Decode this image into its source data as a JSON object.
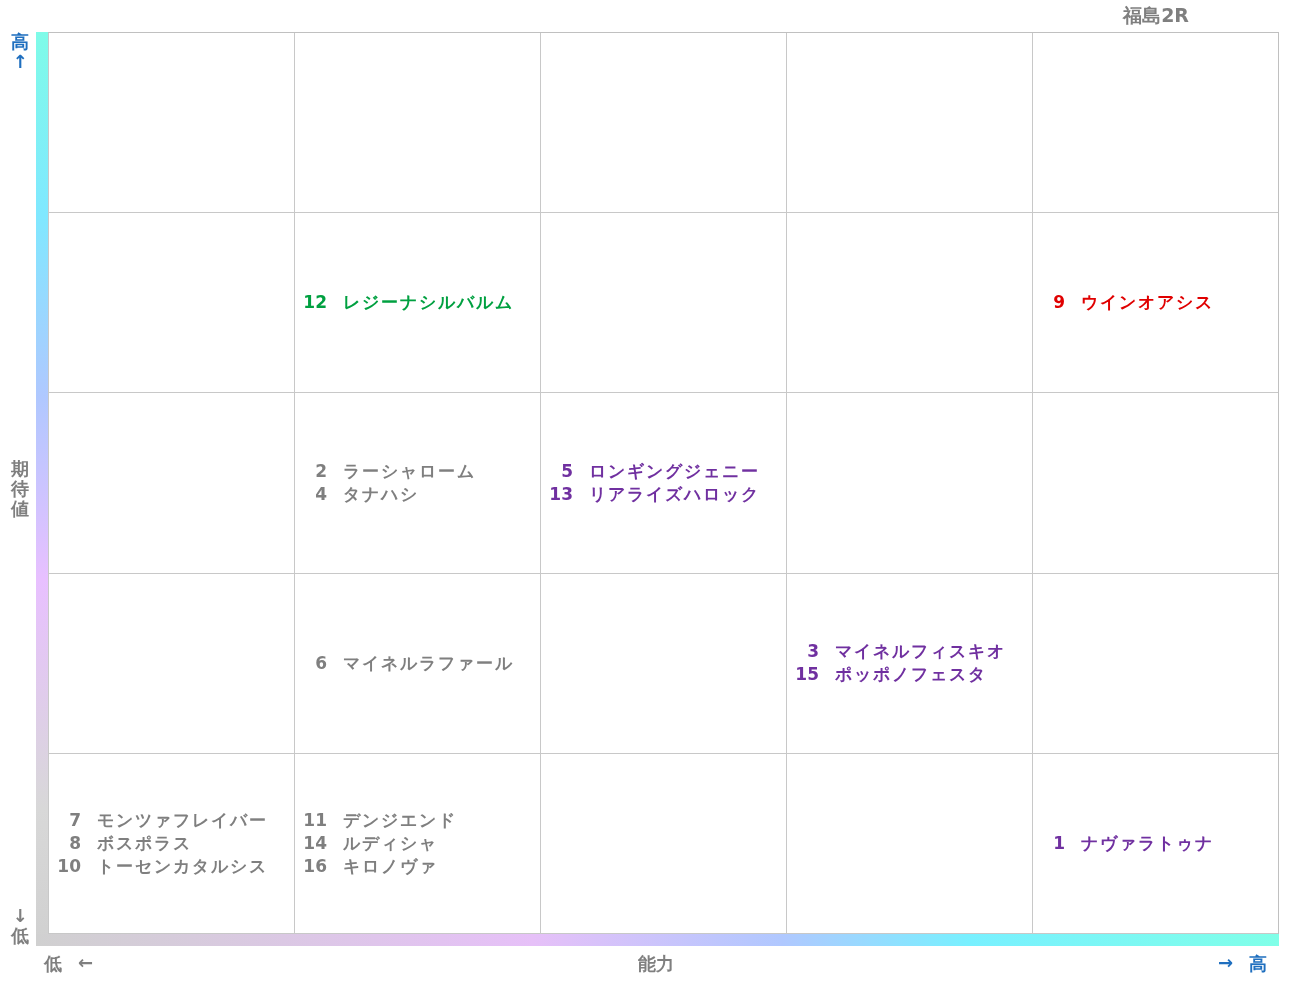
{
  "title": "福島2R",
  "y_axis": {
    "high": "高↑",
    "label": "期待値",
    "low": "↓低"
  },
  "x_axis": {
    "low": "低",
    "low_arrow": "←",
    "label": "能力",
    "high_arrow": "→",
    "high": "高"
  },
  "grid": {
    "row_2": {
      "column_2": [
        {
          "number": "12",
          "name": "レジーナシルバルム",
          "color": "#00a040"
        }
      ],
      "column_5": [
        {
          "number": "9",
          "name": "ウインオアシス",
          "color": "#e00000"
        }
      ]
    },
    "row_3": {
      "column_2": [
        {
          "number": "2",
          "name": "ラーシャローム",
          "color": "#7f7f7f"
        },
        {
          "number": "4",
          "name": "タナハシ",
          "color": "#7f7f7f"
        }
      ],
      "column_3": [
        {
          "number": "5",
          "name": "ロンギングジェニー",
          "color": "#7030a0"
        },
        {
          "number": "13",
          "name": "リアライズハロック",
          "color": "#7030a0"
        }
      ]
    },
    "row_4": {
      "column_2": [
        {
          "number": "6",
          "name": "マイネルラファール",
          "color": "#7f7f7f"
        }
      ],
      "column_4": [
        {
          "number": "3",
          "name": "マイネルフィスキオ",
          "color": "#7030a0"
        },
        {
          "number": "15",
          "name": "ポッポノフェスタ",
          "color": "#7030a0"
        }
      ]
    },
    "row_5": {
      "column_1": [
        {
          "number": "7",
          "name": "モンツァフレイバー",
          "color": "#7f7f7f"
        },
        {
          "number": "8",
          "name": "ボスポラス",
          "color": "#7f7f7f"
        },
        {
          "number": "10",
          "name": "トーセンカタルシス",
          "color": "#7f7f7f"
        }
      ],
      "column_2": [
        {
          "number": "11",
          "name": "デンジエンド",
          "color": "#7f7f7f"
        },
        {
          "number": "14",
          "name": "ルディシャ",
          "color": "#7f7f7f"
        },
        {
          "number": "16",
          "name": "キロノヴァ",
          "color": "#7f7f7f"
        }
      ],
      "column_5": [
        {
          "number": "1",
          "name": "ナヴァラトゥナ",
          "color": "#7030a0"
        }
      ]
    }
  }
}
